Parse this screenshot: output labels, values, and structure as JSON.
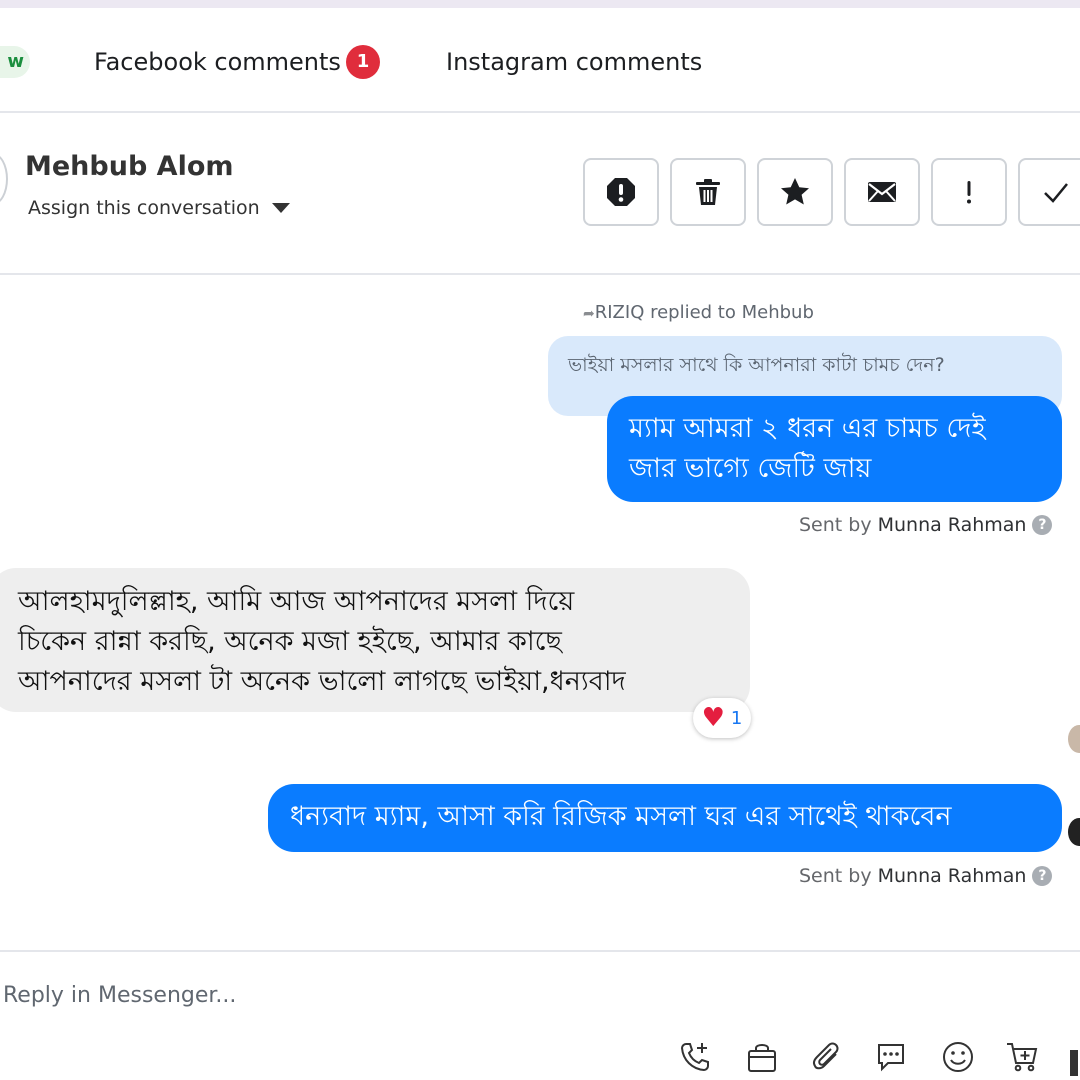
{
  "tabs": {
    "new_label": "w",
    "facebook_label": "Facebook comments",
    "facebook_badge": "1",
    "instagram_label": "Instagram comments"
  },
  "conversation": {
    "contact_name": "Mehbub Alom",
    "assign_label": "Assign this conversation",
    "actions": [
      "spam-icon",
      "trash-icon",
      "star-icon",
      "envelope-icon",
      "exclamation-icon",
      "check-icon"
    ]
  },
  "messages": {
    "reply_context": "RIZIQ replied to Mehbub",
    "quoted_text": "ভাইয়া মসলার সাথে কি আপনারা কাটা চামচ দেন?",
    "reply_1_line_1": "ম্যাম আমরা ২ ধরন এর চামচ দেই",
    "reply_1_line_2": "জার ভাগ্যে জেটি জায়",
    "sent_by_prefix": "Sent by",
    "sent_by_name": "Munna Rahman",
    "incoming_line_1": "আলহামদুলিল্লাহ, আমি আজ আপনাদের মসলা দিয়ে",
    "incoming_line_2": "চিকেন রান্না করছি, অনেক মজা হইছে, আমার কাছে",
    "incoming_line_3": "আপনাদের মসলা টা অনেক ভালো লাগছে ভাইয়া,ধন্যবাদ",
    "reaction_count": "1",
    "reply_2": "ধন্যবাদ ম্যাম, আসা করি রিজিক মসলা ঘর এর সাথেই থাকবেন"
  },
  "composer": {
    "placeholder": "Reply in Messenger...",
    "icons": [
      "call-add-icon",
      "shopping-bag-icon",
      "paperclip-icon",
      "chat-bubble-icon",
      "emoji-icon",
      "cart-add-icon"
    ]
  },
  "colors": {
    "outgoing_bubble": "#0a7cff",
    "quoted_bubble": "#d9e9fb",
    "incoming_bubble": "#eeeeee",
    "badge": "#e02d3c"
  }
}
